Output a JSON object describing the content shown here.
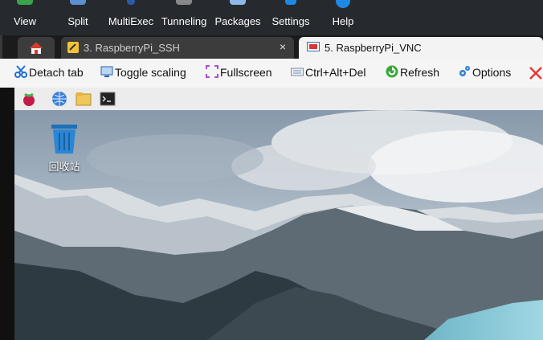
{
  "menu": {
    "items": [
      {
        "label": "View",
        "icon": "view-icon"
      },
      {
        "label": "Split",
        "icon": "split-icon"
      },
      {
        "label": "MultiExec",
        "icon": "multiexec-icon"
      },
      {
        "label": "Tunneling",
        "icon": "tunneling-icon"
      },
      {
        "label": "Packages",
        "icon": "packages-icon"
      },
      {
        "label": "Settings",
        "icon": "gear-icon"
      },
      {
        "label": "Help",
        "icon": "help-icon"
      }
    ]
  },
  "tabs": {
    "ssh_label": "3. RaspberryPi_SSH",
    "vnc_label": "5. RaspberryPi_VNC",
    "close_glyph": "×"
  },
  "toolbar": {
    "detach": "Detach tab",
    "toggle_scaling": "Toggle scaling",
    "fullscreen": "Fullscreen",
    "ctrl_alt_del": "Ctrl+Alt+Del",
    "refresh": "Refresh",
    "options": "Options"
  },
  "desktop": {
    "trash_label": "回收站"
  },
  "colors": {
    "menubar_bg": "#262a2e",
    "accent_blue": "#1e88e5",
    "close_red": "#e53935"
  }
}
